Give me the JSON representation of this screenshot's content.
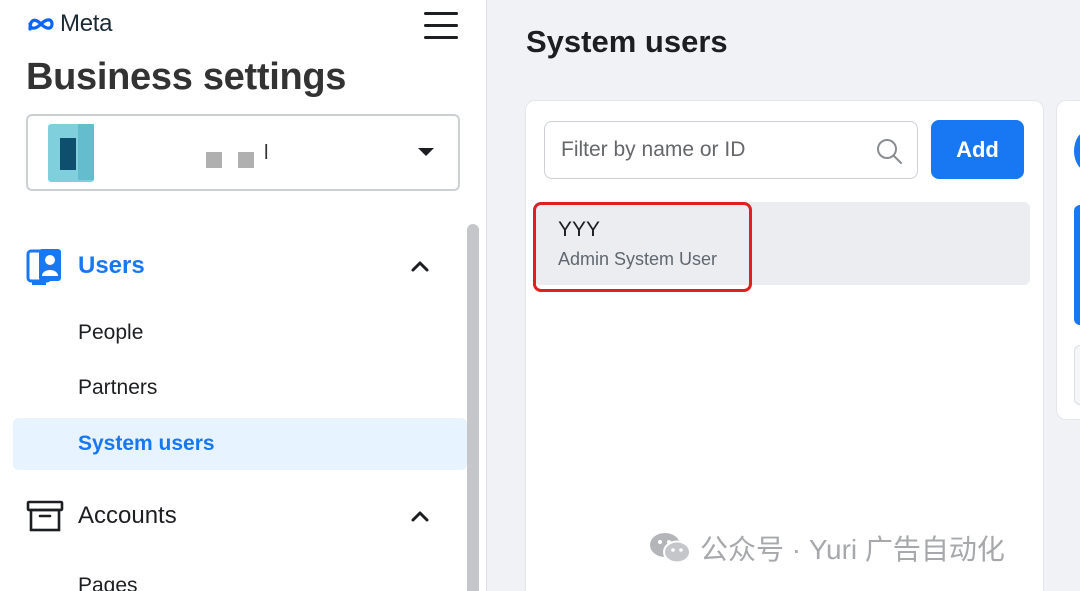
{
  "header": {
    "brand": "Meta",
    "page_heading": "Business settings"
  },
  "account_selector": {
    "name": "l"
  },
  "sidebar": {
    "sections": [
      {
        "label": "Users",
        "icon": "users-icon",
        "expanded": true,
        "items": [
          {
            "label": "People"
          },
          {
            "label": "Partners"
          },
          {
            "label": "System users",
            "selected": true
          }
        ]
      },
      {
        "label": "Accounts",
        "icon": "archive-box-icon",
        "expanded": true,
        "items": [
          {
            "label": "Pages"
          }
        ]
      }
    ]
  },
  "main": {
    "title": "System users",
    "search": {
      "placeholder": "Filter by name or ID",
      "value": ""
    },
    "add_label": "Add",
    "users": [
      {
        "name": "YYY",
        "role": "Admin System User",
        "highlighted": true
      }
    ]
  },
  "watermark": {
    "text": "公众号 · Yuri 广告自动化",
    "icon": "wechat-icon"
  },
  "colors": {
    "accent": "#1877f2",
    "selected_bg": "#e7f3ff",
    "highlight": "#e02020"
  }
}
